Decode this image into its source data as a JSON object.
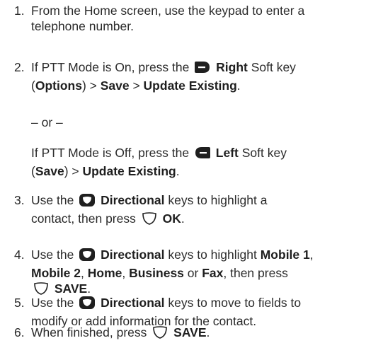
{
  "steps": [
    {
      "number": "1.",
      "lines": [
        [
          "From the Home screen, use the keypad to enter a"
        ],
        [
          "telephone number."
        ]
      ]
    },
    {
      "number": "2.",
      "lines": [
        [
          "If PTT Mode is On, press the ",
          {
            "icon": "right-softkey-icon"
          },
          " ",
          {
            "b": "Right"
          },
          " Soft key"
        ],
        [
          "(",
          {
            "b": "Options"
          },
          ") > ",
          {
            "b": "Save"
          },
          " > ",
          {
            "b": "Update Existing"
          },
          "."
        ]
      ]
    },
    {
      "number": "",
      "lines": [
        [
          "– or –"
        ]
      ]
    },
    {
      "number": "",
      "lines": [
        [
          "If PTT Mode is Off, press the ",
          {
            "icon": "left-softkey-icon"
          },
          " ",
          {
            "b": "Left"
          },
          " Soft key"
        ],
        [
          "(",
          {
            "b": "Save"
          },
          ") > ",
          {
            "b": "Update Existing"
          },
          "."
        ]
      ]
    },
    {
      "number": "3.",
      "lines": [
        [
          "Use the ",
          {
            "icon": "directional-key-icon"
          },
          " ",
          {
            "b": "Directional"
          },
          " keys to highlight a"
        ],
        [
          "contact, then press ",
          {
            "icon": "ok-key-icon"
          },
          " ",
          {
            "b": "OK"
          },
          "."
        ]
      ]
    },
    {
      "number": "4.",
      "lines": [
        [
          "Use the ",
          {
            "icon": "directional-key-icon"
          },
          " ",
          {
            "b": "Directional"
          },
          " keys to highlight ",
          {
            "b": "Mobile 1"
          },
          ","
        ],
        [
          {
            "b": "Mobile 2"
          },
          ", ",
          {
            "b": "Home"
          },
          ", ",
          {
            "b": "Business"
          },
          " or ",
          {
            "b": "Fax"
          },
          ", then press"
        ],
        [
          {
            "icon": "ok-key-icon"
          },
          " ",
          {
            "b": "SAVE"
          },
          "."
        ]
      ]
    },
    {
      "number": "5.",
      "lines": [
        [
          "Use the ",
          {
            "icon": "directional-key-icon"
          },
          " ",
          {
            "b": "Directional"
          },
          " keys to move to fields to"
        ],
        [
          "modify or add information for the contact."
        ]
      ]
    },
    {
      "number": "6.",
      "lines": [
        [
          "When finished, press ",
          {
            "icon": "ok-key-icon"
          },
          " ",
          {
            "b": "SAVE"
          },
          "."
        ]
      ]
    }
  ]
}
